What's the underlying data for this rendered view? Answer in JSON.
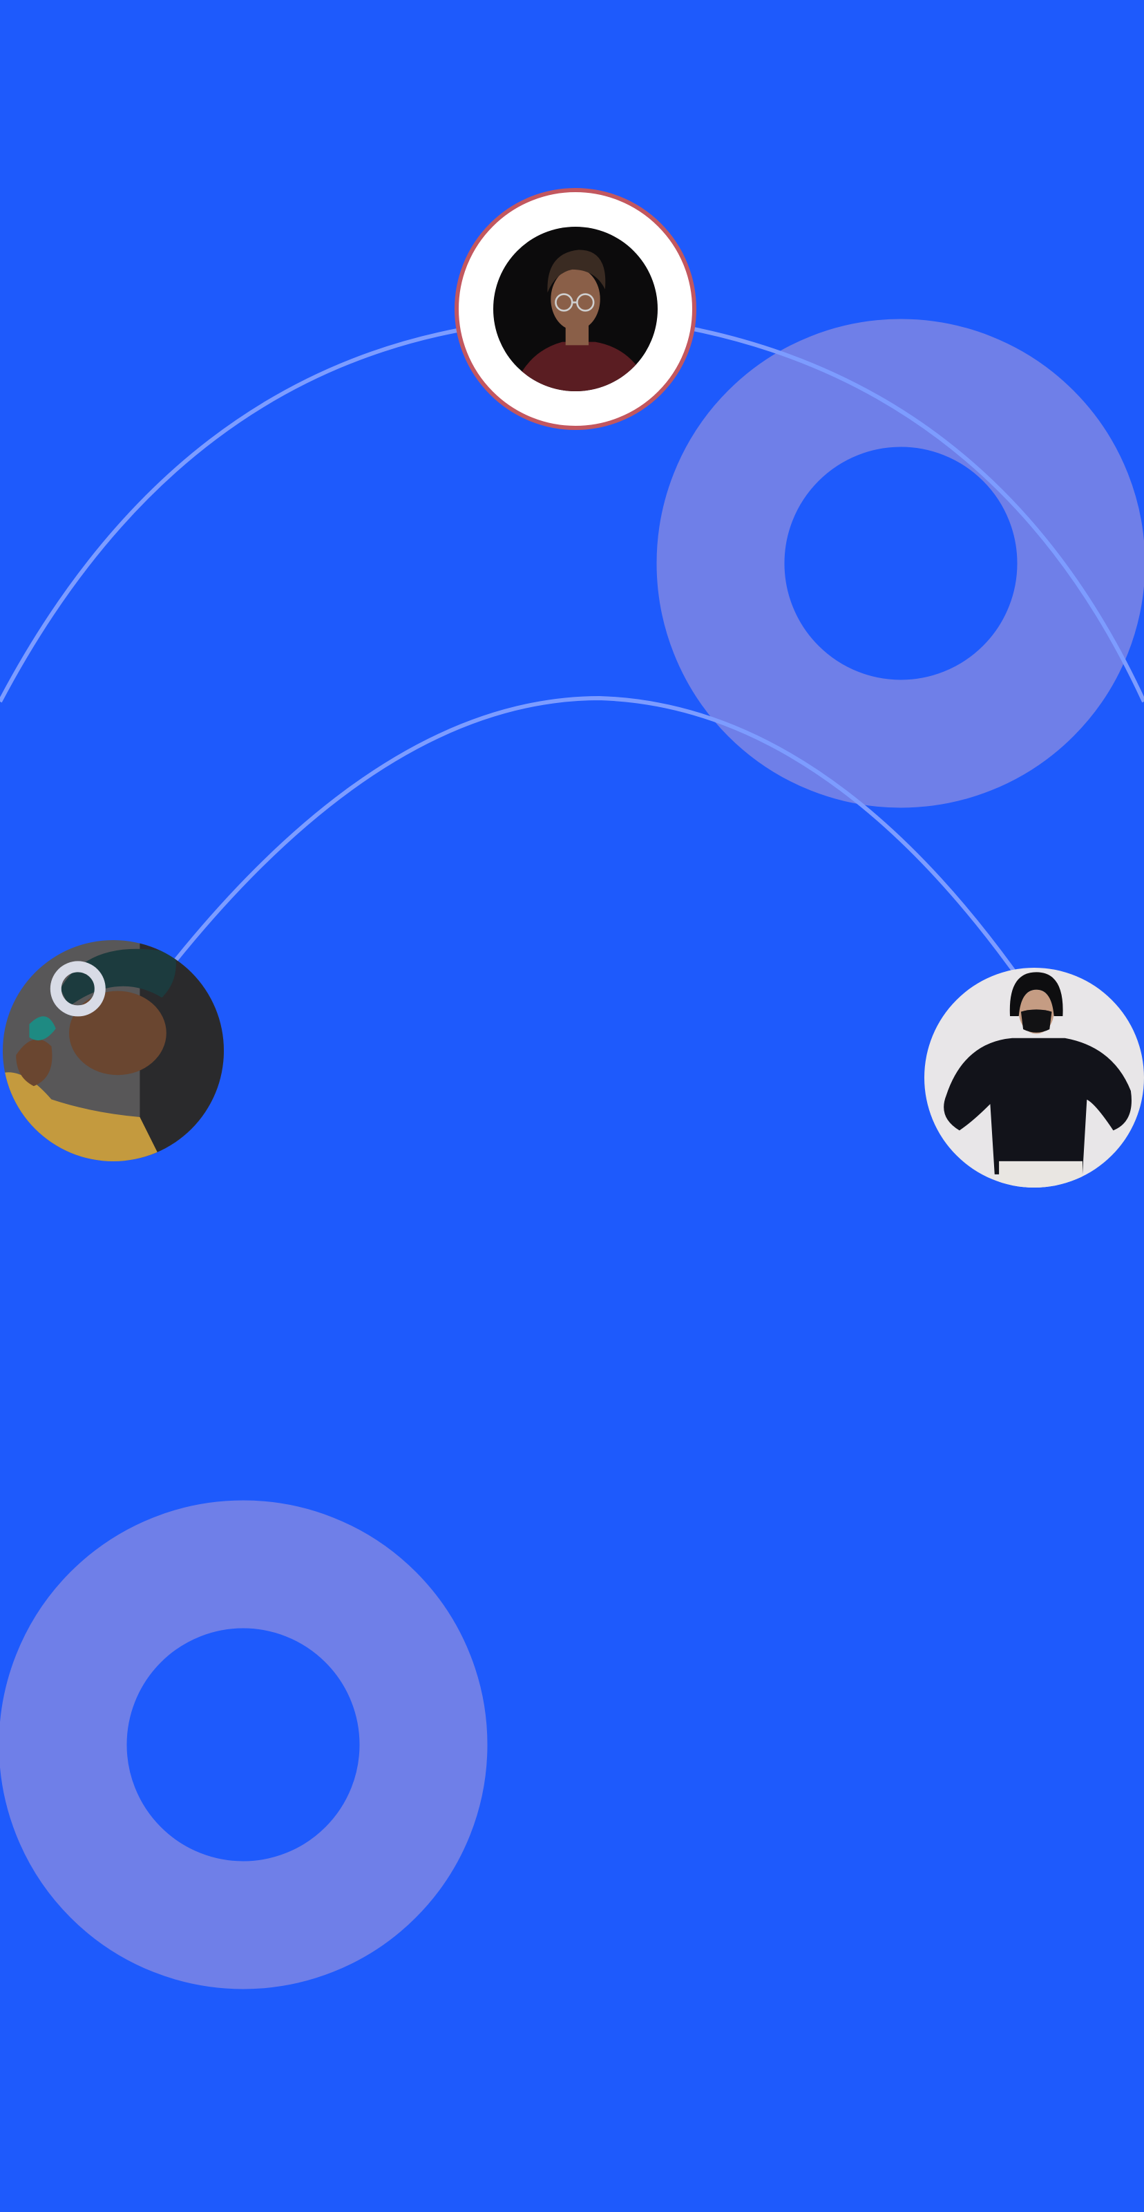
{
  "theme": {
    "background": "#1e5afc",
    "ring_decor": "#6f7fe8",
    "arc_line": "#7d9cff",
    "featured_ring_border": "#c2575f",
    "featured_ring_fill": "#ffffff"
  },
  "people": [
    {
      "role": "featured",
      "icon": "person-with-glasses-avatar-icon",
      "palette": {
        "bg": "#0c0b0c",
        "skin": "#8a5f48",
        "hair": "#3a2b22",
        "shirt": "#5a1d22"
      }
    },
    {
      "role": "left",
      "icon": "person-with-headphones-avatar-icon",
      "palette": {
        "bg": "#585758",
        "skin": "#6a4630",
        "hair": "#1c3b3e",
        "shirt": "#c49a3e",
        "headphones": "#d8dbe6"
      }
    },
    {
      "role": "right",
      "icon": "person-with-face-mask-avatar-icon",
      "palette": {
        "bg": "#e8e6e8",
        "skin": "#c59c83",
        "hair": "#0e0e10",
        "shirt": "#12131a",
        "mask": "#121214"
      }
    }
  ]
}
